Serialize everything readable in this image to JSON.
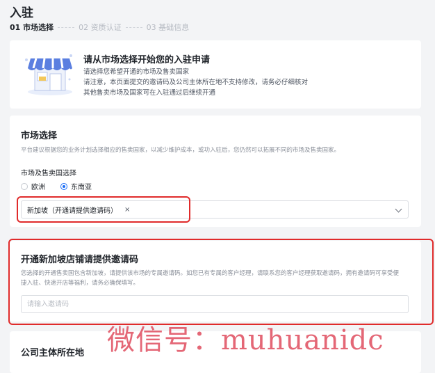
{
  "page": {
    "title": "入驻"
  },
  "steps": [
    {
      "label": "01 市场选择"
    },
    {
      "label": "02 资质认证"
    },
    {
      "label": "03 基础信息"
    }
  ],
  "intro": {
    "title": "请从市场选择开始您的入驻申请",
    "lines": [
      "请选择您希望开通的市场及售卖国家",
      "请注意，本页面提交的邀请码及公司主体所在地不支持修改，请务必仔细核对",
      "其他售卖市场及国家可在入驻通过后继续开通"
    ]
  },
  "market": {
    "title": "市场选择",
    "desc": "平台建议根据您的业务计划选择相应的售卖国家，以减少维护成本，或功入驻后，您仍然可以拓展不同的市场及售卖国家。",
    "field_label": "市场及售卖国选择",
    "options": [
      {
        "label": "欧洲",
        "checked": false
      },
      {
        "label": "东南亚",
        "checked": true
      }
    ],
    "selected_tag": "新加坡（开通请提供邀请码）",
    "tag_close": "×"
  },
  "invite": {
    "title": "开通新加坡店铺请提供邀请码",
    "desc_line1": "您选择的开通售卖国包含新加坡，请提供该市场的专属邀请码。如您已有专属的客户经理，请联系您的客户经理获取邀请码，拥有邀请码可享受便",
    "desc_line2": "捷入驻、快速开店等福利，请务必确保填写。",
    "placeholder": "请输入邀请码",
    "value": ""
  },
  "company": {
    "title": "公司主体所在地"
  },
  "watermark": {
    "text": "微信号：muhuanidc"
  },
  "colors": {
    "accent": "#1a6cf5",
    "highlight": "#e02b2b",
    "watermark": "#dc3c50"
  }
}
